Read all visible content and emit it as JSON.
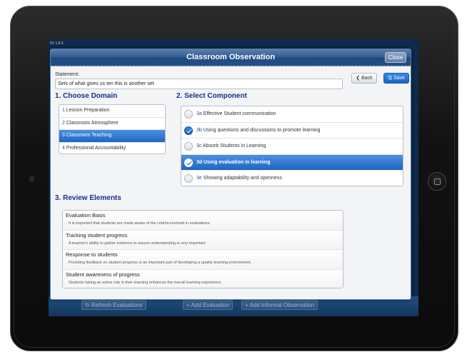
{
  "app": {
    "version": "5V 1.8.6"
  },
  "modal": {
    "title": "Classroom Observation",
    "close_label": "Close",
    "back_label": "❮ Back",
    "save_label": "🖫 Save"
  },
  "statement": {
    "label": "Statement:",
    "value": "Sets of what gives us ten this is another set"
  },
  "sections": {
    "domain": "1. Choose Domain",
    "component": "2. Select Component",
    "review": "3. Review Elements"
  },
  "domains": [
    {
      "num": "1",
      "label": "Lesson Preparation",
      "selected": false
    },
    {
      "num": "2",
      "label": "Classroom Atmosphere",
      "selected": false
    },
    {
      "num": "3",
      "label": "Classroom Teaching",
      "selected": true
    },
    {
      "num": "4",
      "label": "Professional Accountability",
      "selected": false
    }
  ],
  "components": [
    {
      "code": "3a",
      "label": "Effective Student communication",
      "checked": false,
      "selected": false
    },
    {
      "code": "3b",
      "label": "Using questions and discussions to promote learning",
      "checked": true,
      "selected": false
    },
    {
      "code": "3c",
      "label": "Absorb Students in Learning",
      "checked": false,
      "selected": false
    },
    {
      "code": "3d",
      "label": "Using evaluation in learning",
      "checked": true,
      "selected": true
    },
    {
      "code": "3e",
      "label": "Showing adaptability and openness",
      "checked": false,
      "selected": false
    }
  ],
  "review_elements": [
    {
      "title": "Evaluation Basis",
      "desc": "It is important that students are made aware of the criteria involved in evaluations."
    },
    {
      "title": "Tracking student progress",
      "desc": "A teacher's ability to gather evidence to assure understanding is very important"
    },
    {
      "title": "Response to students",
      "desc": "Providing feedback on student progress is an important part of developing a quality learning environment."
    },
    {
      "title": "Student awareness of progress",
      "desc": "Students taking an active role in their learning enhances the overall learning experience."
    }
  ],
  "background_toolbar": {
    "refresh": "↻ Refresh Evaluations",
    "add_evaluation": "+ Add Evaluation",
    "add_informal": "+ Add Informal Observation"
  },
  "colors": {
    "accent": "#1f66c2",
    "section_title": "#16308a",
    "header": "#244f86"
  }
}
